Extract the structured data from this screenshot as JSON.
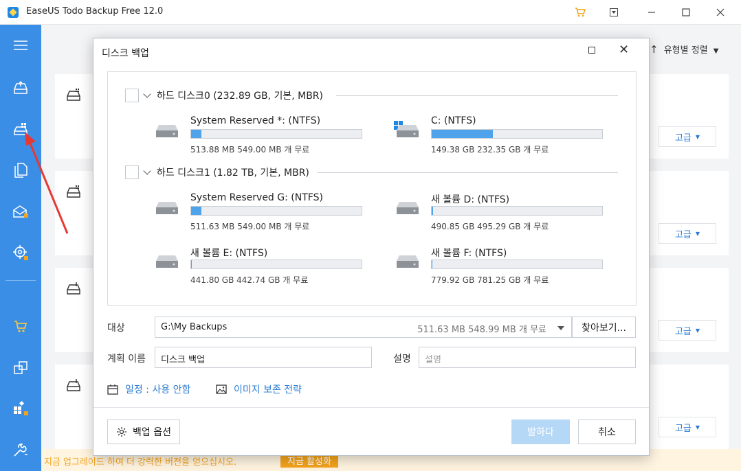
{
  "app": {
    "title": "EaseUS Todo Backup Free 12.0"
  },
  "titlebar_icons": [
    "cart-icon",
    "menu-dropdown-icon",
    "minimize-icon",
    "maximize-icon",
    "close-icon"
  ],
  "sidebar": {
    "items": [
      {
        "icon": "hamburger-icon"
      },
      {
        "icon": "disk-backup-icon"
      },
      {
        "icon": "system-backup-icon"
      },
      {
        "icon": "file-backup-icon"
      },
      {
        "icon": "mail-backup-icon"
      },
      {
        "icon": "smart-backup-icon"
      },
      {
        "icon": "cart-icon"
      },
      {
        "icon": "clone-icon"
      },
      {
        "icon": "apps-icon"
      },
      {
        "icon": "tools-icon"
      }
    ]
  },
  "main": {
    "sort_label": "유형별 정렬",
    "advanced_label": "고급",
    "upgrade_text": "지금 업그레이드 하여 더 강력한 버전을 얻으십시오.",
    "upgrade_button": "지금 활성화"
  },
  "dialog": {
    "title": "디스크 백업",
    "disks": [
      {
        "name": "하드 디스크0 (232.89 GB, 기본, MBR)",
        "partitions": [
          {
            "name": "System Reserved *: (NTFS)",
            "size": "513.88 MB 549.00 MB 개 무료",
            "used_fraction": 0.06,
            "icon": "drive-icon"
          },
          {
            "name": "C: (NTFS)",
            "size": "149.38 GB 232.35 GB 개 무료",
            "used_fraction": 0.36,
            "icon": "windows-drive-icon"
          }
        ]
      },
      {
        "name": "하드 디스크1 (1.82 TB, 기본, MBR)",
        "partitions": [
          {
            "name": "System Reserved G: (NTFS)",
            "size": "511.63 MB 549.00 MB 개 무료",
            "used_fraction": 0.06,
            "icon": "drive-icon"
          },
          {
            "name": "새 볼륨 D: (NTFS)",
            "size": "490.85 GB 495.29 GB 개 무료",
            "used_fraction": 0.01,
            "icon": "drive-icon"
          },
          {
            "name": "새 볼륨 E: (NTFS)",
            "size": "441.80 GB 442.74 GB 개 무료",
            "used_fraction": 0.005,
            "icon": "drive-icon"
          },
          {
            "name": "새 볼륨 F: (NTFS)",
            "size": "779.92 GB 781.25 GB 개 무료",
            "used_fraction": 0.005,
            "icon": "drive-icon"
          }
        ]
      }
    ],
    "target_label": "대상",
    "target_path": "G:\\My Backups",
    "target_free": "511.63 MB 548.99 MB 개 무료",
    "browse_label": "찾아보기...",
    "plan_label": "계획 이름",
    "plan_value": "디스크 백업",
    "desc_label": "설명",
    "desc_placeholder": "설명",
    "schedule_link": "일정 : 사용 안함",
    "image_strategy_link": "이미지 보존 전략",
    "options_button": "백업 옵션",
    "execute_button": "발하다",
    "cancel_button": "취소"
  },
  "colors": {
    "sidebar": "#3a8ee6",
    "accent_blue": "#2a7bd3",
    "usage_fill": "#4fa3ea",
    "upgrade_orange": "#f4a31b",
    "annotation_red": "#e53935"
  }
}
